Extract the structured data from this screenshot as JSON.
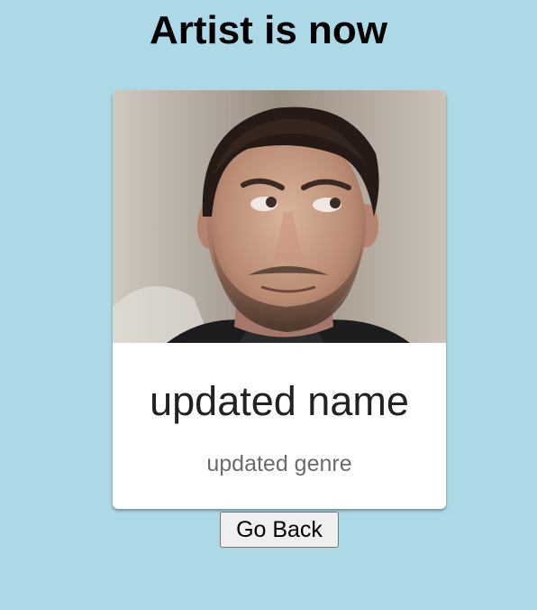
{
  "page": {
    "title": "Artist is now",
    "background_color": "#add8e6"
  },
  "artist": {
    "name": "updated name",
    "genre": "updated genre",
    "photo": "man-portrait-photo"
  },
  "actions": {
    "go_back_label": "Go Back"
  }
}
